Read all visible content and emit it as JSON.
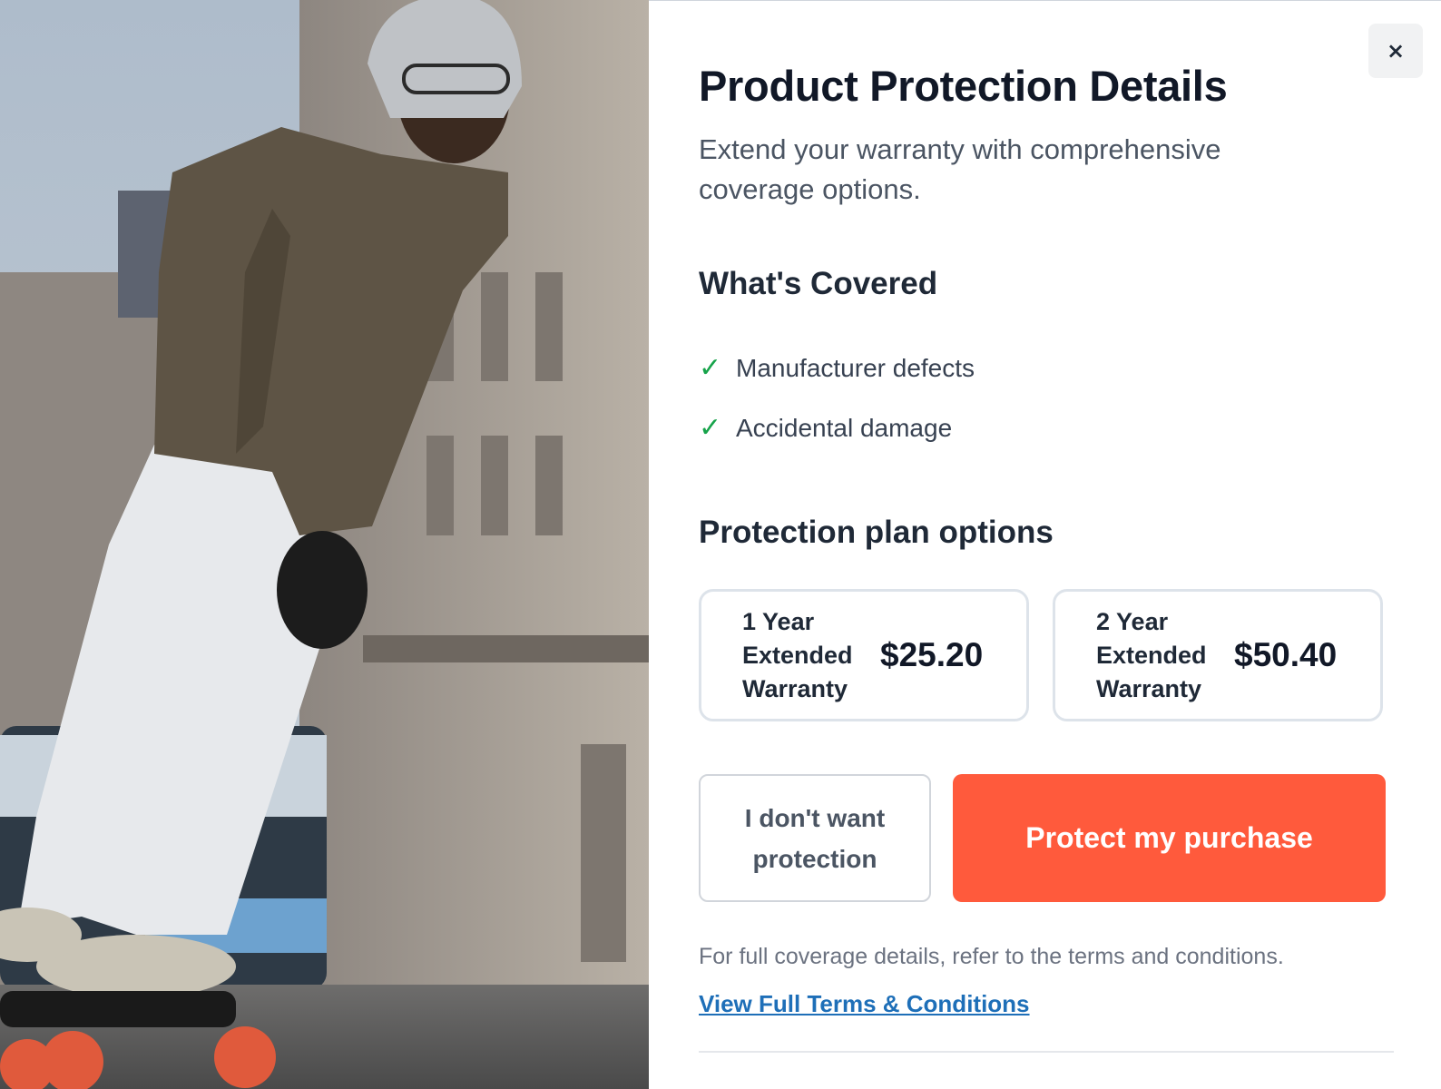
{
  "close": {
    "label": "×"
  },
  "title": "Product Protection Details",
  "subtitle": "Extend your warranty with comprehensive coverage options.",
  "covered": {
    "heading": "What's Covered",
    "items": [
      {
        "label": "Manufacturer defects",
        "icon": "check-icon"
      },
      {
        "label": "Accidental damage",
        "icon": "check-icon"
      }
    ]
  },
  "plans": {
    "heading": "Protection plan options",
    "options": [
      {
        "name": "1 Year Extended Warranty",
        "price": "$25.20"
      },
      {
        "name": "2 Year Extended Warranty",
        "price": "$50.40"
      }
    ]
  },
  "actions": {
    "decline_label": "I don't want protection",
    "protect_label": "Protect my purchase"
  },
  "terms": {
    "note": "For full coverage details, refer to the terms and conditions.",
    "link_label": "View Full Terms & Conditions"
  },
  "colors": {
    "accent": "#ff5a3c",
    "check": "#16a34a",
    "link": "#1e6fb8"
  }
}
